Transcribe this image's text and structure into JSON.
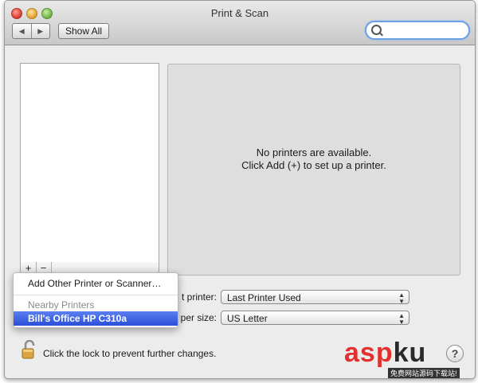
{
  "window": {
    "title": "Print & Scan"
  },
  "toolbar": {
    "back_icon": "back-arrow-icon",
    "forward_icon": "forward-arrow-icon",
    "show_all_label": "Show All",
    "search": {
      "placeholder": "",
      "value": ""
    }
  },
  "printers": {
    "items": []
  },
  "list_controls": {
    "add_label": "+",
    "remove_label": "−"
  },
  "detail": {
    "message_line1": "No printers are available.",
    "message_line2": "Click Add (+) to set up a printer."
  },
  "settings": {
    "default_printer_label": "t printer:",
    "default_printer_value": "Last Printer Used",
    "paper_size_label": "per size:",
    "paper_size_value": "US Letter"
  },
  "lock": {
    "text": "Click the lock to prevent further changes.",
    "icon": "padlock-open-icon"
  },
  "help": {
    "label": "?"
  },
  "add_menu": {
    "add_other": "Add Other Printer or Scanner…",
    "nearby_header": "Nearby Printers",
    "nearby_item": "Bill's Office HP C310a"
  },
  "watermark": {
    "red": "asp",
    "dark": "ku",
    "sub": "免费网站源码下载站!"
  },
  "colors": {
    "selection": "#2a4fd8",
    "search_focus": "#6aa1e3",
    "watermark_red": "#e3302f"
  }
}
